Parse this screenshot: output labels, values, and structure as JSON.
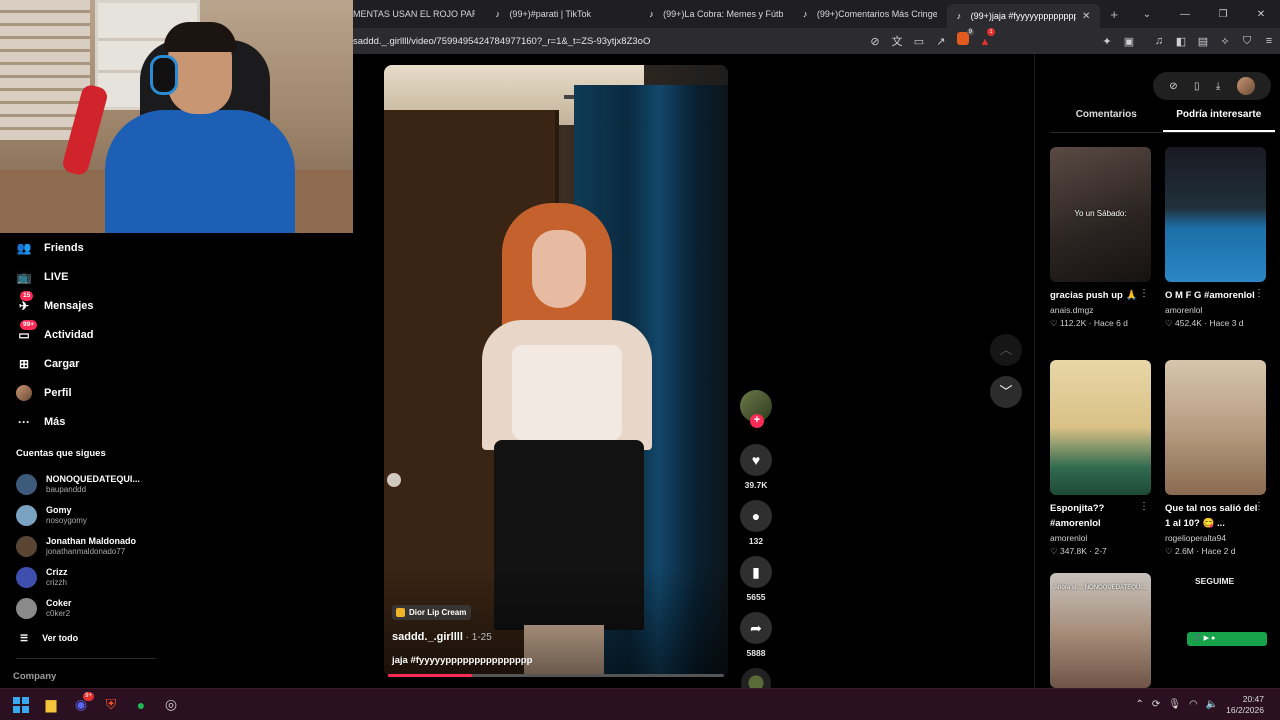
{
  "browser": {
    "tabs": [
      {
        "label": "MENTAS USAN EL ROJO PARA EVITA",
        "active": false
      },
      {
        "label": "(99+)#parati | TikTok",
        "active": false
      },
      {
        "label": "(99+)La Cobra: Memes y Fútbol en A",
        "active": false
      },
      {
        "label": "(99+)Comentarios Más Cringe de Tik",
        "active": false
      },
      {
        "label": "(99+)jaja #fyyyyyppppppppppppp",
        "active": true
      }
    ],
    "url": "saddd._.girllll/video/7599495424784977160?_r=1&_t=ZS-93ytjx8Z3oO",
    "brave_shield_count": "9",
    "rewards_count": "1"
  },
  "sidebar": {
    "nav": [
      {
        "label": "Friends",
        "icon": "friends-icon"
      },
      {
        "label": "LIVE",
        "icon": "live-icon"
      },
      {
        "label": "Mensajes",
        "icon": "messages-icon",
        "badge": "15"
      },
      {
        "label": "Actividad",
        "icon": "activity-icon",
        "badge": "99+"
      },
      {
        "label": "Cargar",
        "icon": "upload-icon"
      },
      {
        "label": "Perfil",
        "icon": "profile-avatar"
      },
      {
        "label": "Más",
        "icon": "more-icon"
      }
    ],
    "following_title": "Cuentas que sigues",
    "following": [
      {
        "name": "NONOQUEDATEQUI...",
        "user": "baupanddd",
        "color": "#3d5a7a"
      },
      {
        "name": "Gomy",
        "user": "nosoygomy",
        "color": "#7aa3c2"
      },
      {
        "name": "Jonathan Maldonado",
        "user": "jonathanmaldonado77",
        "color": "#5a4535"
      },
      {
        "name": "Crizz",
        "user": "crizzh",
        "color": "#3f4fb0"
      },
      {
        "name": "Coker",
        "user": "c0ker2",
        "color": "#8a8a8a"
      }
    ],
    "see_all": "Ver todo",
    "company": "Company"
  },
  "video": {
    "tag": "Dior Lip Cream",
    "author": "saddd._.girllll",
    "date": " · 1-25",
    "caption": "jaja #fyyyyyppppppppppppppp",
    "progress": 0.25,
    "likes": "39.7K",
    "comments": "132",
    "saves": "5655",
    "shares": "5888"
  },
  "right_panel": {
    "tabs": [
      "Comentarios",
      "Podría interesarte"
    ],
    "active_tab": 1,
    "cards": [
      {
        "title": "gracias push up 🙏",
        "user": "anais.dmgz",
        "likes": "112.2K",
        "age": "Hace 6 d",
        "overlay": "Yo un Sábado:",
        "bg": "linear-gradient(160deg,#5a4a44,#2a2320 60%,#151212)"
      },
      {
        "title": "O M F G #amorenlol",
        "user": "amorenlol",
        "likes": "452.4K",
        "age": "Hace 3 d",
        "overlay": "",
        "bg": "linear-gradient(180deg,#1a1a22 0%,#20303a 45%,#1d6fa8 60%,#2a86c4 100%)"
      },
      {
        "title": "Esponjita?? #amorenlol",
        "user": "amorenlol",
        "likes": "347.8K",
        "age": "2-7",
        "overlay": "",
        "bg": "linear-gradient(180deg,#e8d7a8 0%,#d9c186 50%,#2f6a4f 80%,#1e4a36 100%)"
      },
      {
        "title": "Que tal nos salió del 1 al 10? 😋 ...",
        "user": "rogelioperalta94",
        "likes": "2.6M",
        "age": "Hace 2 d",
        "overlay": "",
        "bg": "linear-gradient(180deg,#d6c6ad 0%,#b89e82 50%,#8a6a50 100%)"
      },
      {
        "title": "",
        "user": "",
        "likes": "",
        "age": "",
        "overlay": "Ahora sí ... NONOQUEDATEQUI...",
        "bg": "linear-gradient(180deg,#c7c2bd 0%,#a88f7c 50%,#6f5546 100%)"
      }
    ],
    "follow_label": "SEGUIME",
    "green_bar": "🎵 ▶ ●"
  },
  "taskbar": {
    "time": "20:47",
    "date": "16/2/2026",
    "discord_badge": "9+"
  },
  "colors": {
    "accent": "#fe2c55"
  }
}
